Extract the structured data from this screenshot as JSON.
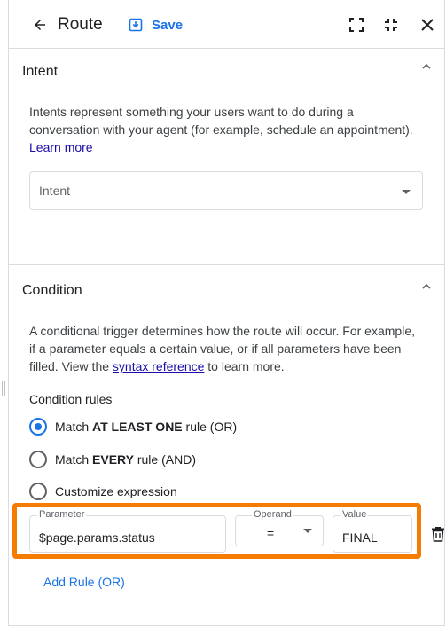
{
  "header": {
    "title": "Route",
    "save_label": "Save"
  },
  "intent": {
    "title": "Intent",
    "description": "Intents represent something your users want to do during a conversation with your agent (for example, schedule an appointment).",
    "learn_more": "Learn more",
    "select_placeholder": "Intent"
  },
  "condition": {
    "title": "Condition",
    "description_before": "A conditional trigger determines how the route will occur. For example, if a parameter equals a certain value, or if all parameters have been filled. View the",
    "syntax_link": "syntax reference",
    "description_after": "to learn more.",
    "rules_title": "Condition rules",
    "options": {
      "or_prefix": "Match",
      "or_bold": "AT LEAST ONE",
      "or_suffix": "rule (OR)",
      "and_prefix": "Match",
      "and_bold": "EVERY",
      "and_suffix": "rule (AND)",
      "custom": "Customize expression"
    },
    "selected_option": "or",
    "rule": {
      "parameter_label": "Parameter",
      "parameter_value": "$page.params.status",
      "operand_label": "Operand",
      "operand_value": "=",
      "value_label": "Value",
      "value_value": "FINAL"
    },
    "add_rule": "Add Rule (OR)"
  },
  "colors": {
    "accent": "#1a73e8",
    "highlight": "#f57c00",
    "link": "#1a0dab"
  },
  "icons": [
    "arrow-back-icon",
    "save-icon",
    "fullscreen-icon",
    "fullscreen-exit-icon",
    "close-icon",
    "chevron-up-icon",
    "dropdown-caret-icon",
    "delete-icon"
  ]
}
